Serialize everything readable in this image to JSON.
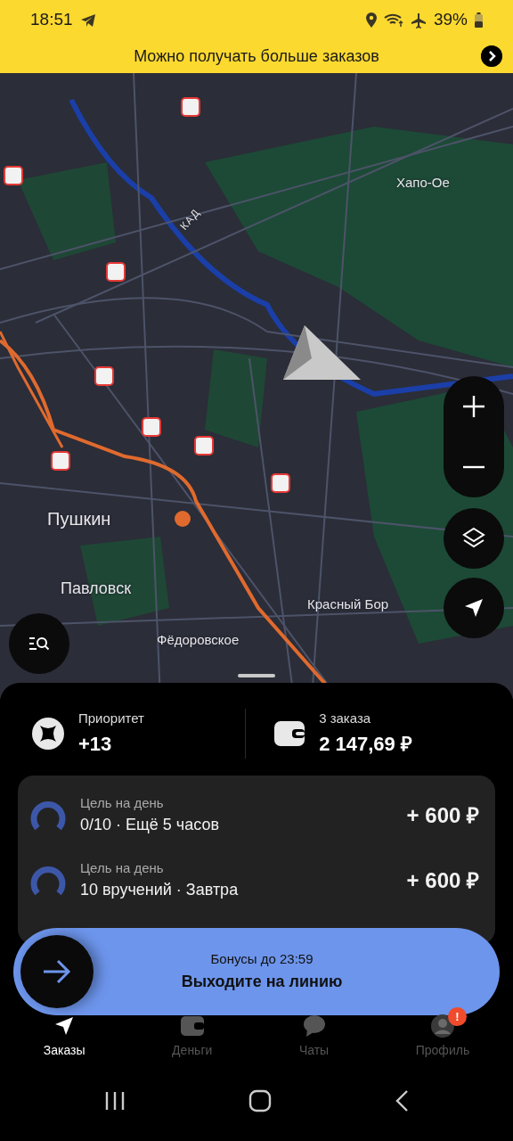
{
  "status_bar": {
    "time": "18:51",
    "battery": "39%"
  },
  "banner": {
    "text": "Можно получать больше заказов"
  },
  "map": {
    "labels": [
      {
        "text": "Хапо-Ое",
        "kind": "place"
      },
      {
        "text": "КАД",
        "kind": "road"
      },
      {
        "text": "Пушкин",
        "kind": "city"
      },
      {
        "text": "Павловск",
        "kind": "town"
      },
      {
        "text": "Красный Бор",
        "kind": "place"
      },
      {
        "text": "Фёдоровское",
        "kind": "place"
      }
    ]
  },
  "summary": [
    {
      "kind": "priority",
      "label": "Приоритет",
      "value": "+13"
    },
    {
      "kind": "wallet",
      "label": "3 заказа",
      "value": "2 147,69 ₽"
    }
  ],
  "goals": [
    {
      "title": "Цель на день",
      "subtitle": "0/10 · Ещё 5 часов",
      "reward": "+ 600 ₽",
      "level": 0
    },
    {
      "title": "Цель на день",
      "subtitle": "10 вручений · Завтра",
      "reward": "+ 600 ₽",
      "level": 0
    }
  ],
  "go_button": {
    "caption": "Бонусы до 23:59",
    "title": "Выходите на линию",
    "level": 0
  },
  "tabs": [
    {
      "kind": "orders",
      "label": "Заказы",
      "selected": true
    },
    {
      "kind": "money",
      "label": "Деньги",
      "selected": false
    },
    {
      "kind": "chats",
      "label": "Чаты",
      "selected": false
    },
    {
      "kind": "profile",
      "label": "Профиль",
      "selected": false,
      "badge": "!"
    }
  ]
}
